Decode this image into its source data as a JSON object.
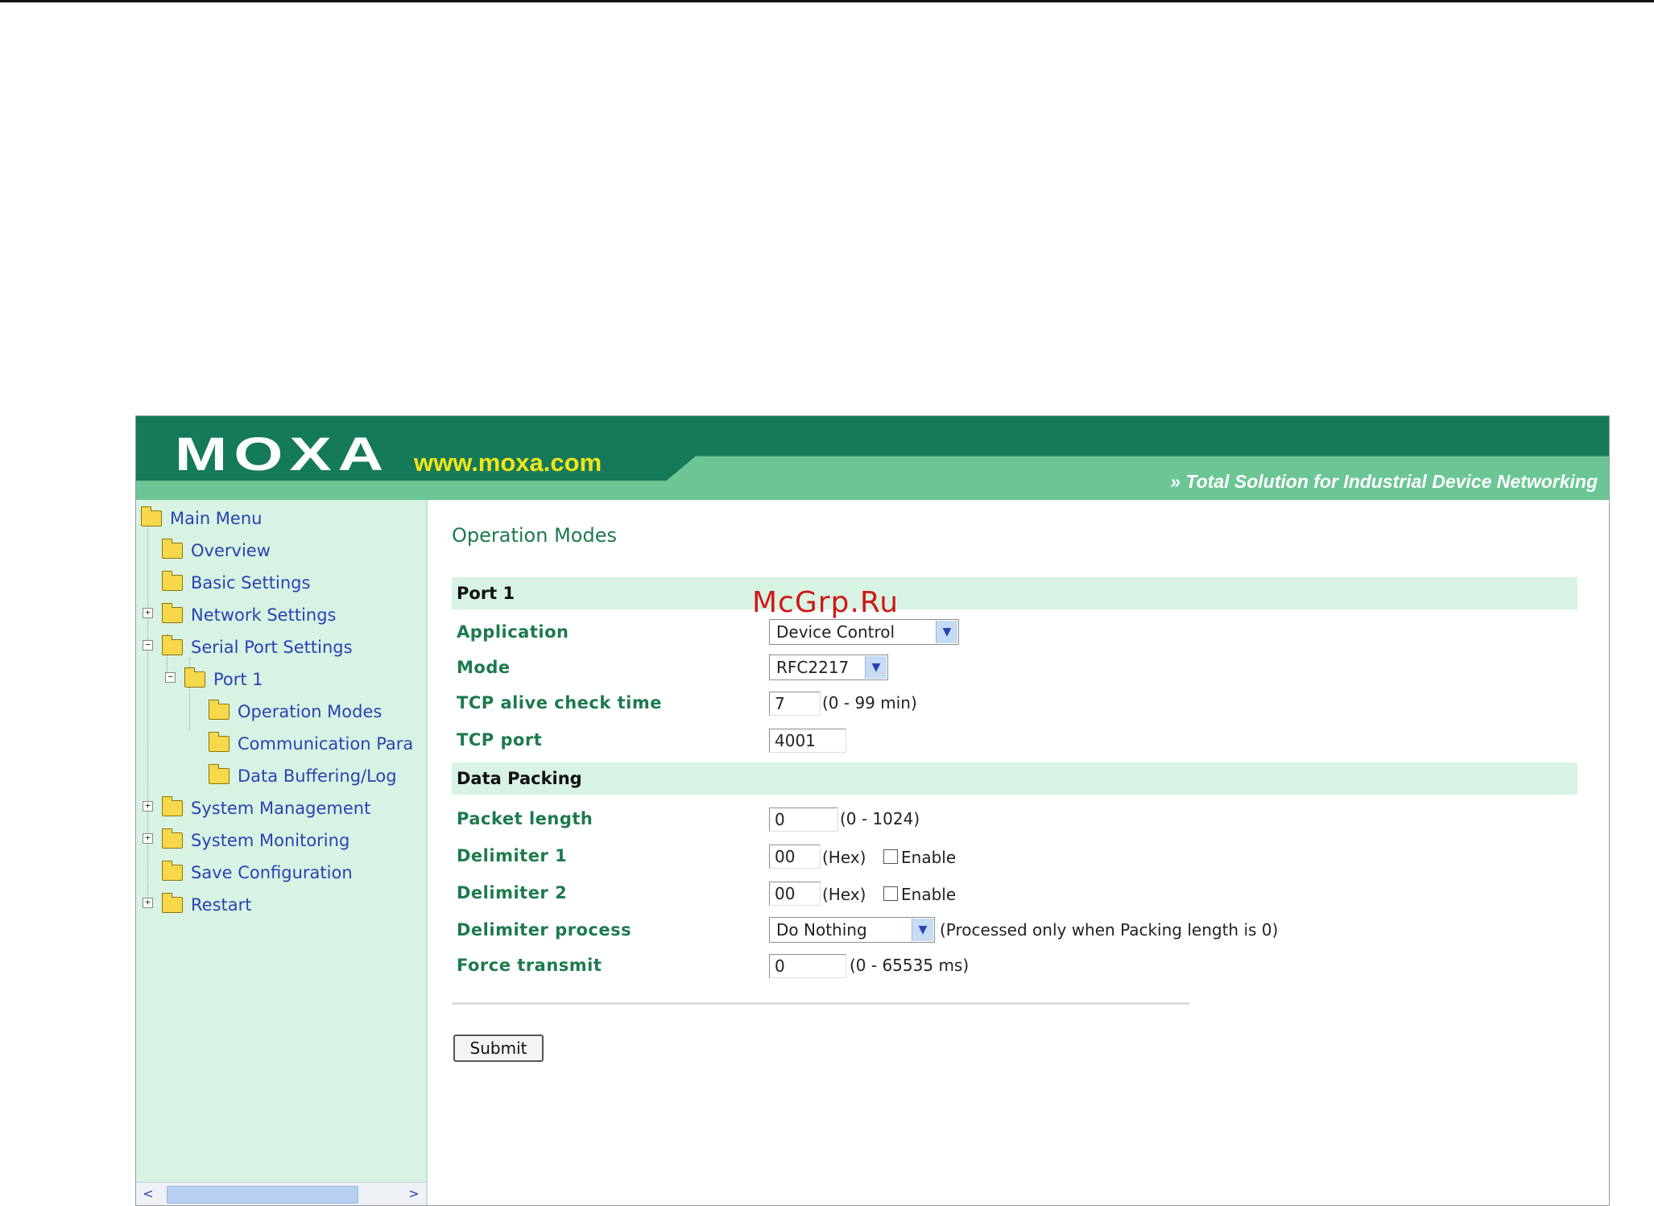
{
  "watermark": "McGrp.Ru",
  "header": {
    "logo": "MOXA",
    "site": "www.moxa.com",
    "slogan": "» Total Solution for Industrial Device Networking"
  },
  "sidebar": {
    "items": [
      {
        "label": "Main Menu"
      },
      {
        "label": "Overview"
      },
      {
        "label": "Basic Settings"
      },
      {
        "label": "Network Settings"
      },
      {
        "label": "Serial Port Settings"
      },
      {
        "label": "Port 1"
      },
      {
        "label": "Operation Modes"
      },
      {
        "label": "Communication Para"
      },
      {
        "label": "Data Buffering/Log"
      },
      {
        "label": "System Management"
      },
      {
        "label": "System Monitoring"
      },
      {
        "label": "Save Configuration"
      },
      {
        "label": "Restart"
      }
    ],
    "expander_plus": "+",
    "expander_minus": "−"
  },
  "main": {
    "title": "Operation Modes",
    "port_section": "Port 1",
    "application": {
      "label": "Application",
      "value": "Device Control"
    },
    "mode": {
      "label": "Mode",
      "value": "RFC2217"
    },
    "tcp_alive": {
      "label": "TCP alive check time",
      "value": "7",
      "hint": "(0 - 99 min)"
    },
    "tcp_port": {
      "label": "TCP port",
      "value": "4001"
    },
    "packing_section": "Data Packing",
    "packet_length": {
      "label": "Packet length",
      "value": "0",
      "hint": "(0 - 1024)"
    },
    "delimiter1": {
      "label": "Delimiter 1",
      "value": "00",
      "hex": "(Hex)",
      "enable": "Enable"
    },
    "delimiter2": {
      "label": "Delimiter 2",
      "value": "00",
      "hex": "(Hex)",
      "enable": "Enable"
    },
    "delimiter_process": {
      "label": "Delimiter process",
      "value": "Do Nothing",
      "hint": "(Processed only when Packing length is 0)"
    },
    "force_transmit": {
      "label": "Force transmit",
      "value": "0",
      "hint": "(0 - 65535 ms)"
    },
    "submit": "Submit"
  },
  "scrollbar": {
    "left": "<",
    "right": ">"
  },
  "colors": {
    "banner_dark": "#157a59",
    "banner_light": "#6cc595",
    "sidebar_bg": "#d8f3e3",
    "label_green": "#1d7a4d",
    "link_blue": "#2a43b3"
  }
}
